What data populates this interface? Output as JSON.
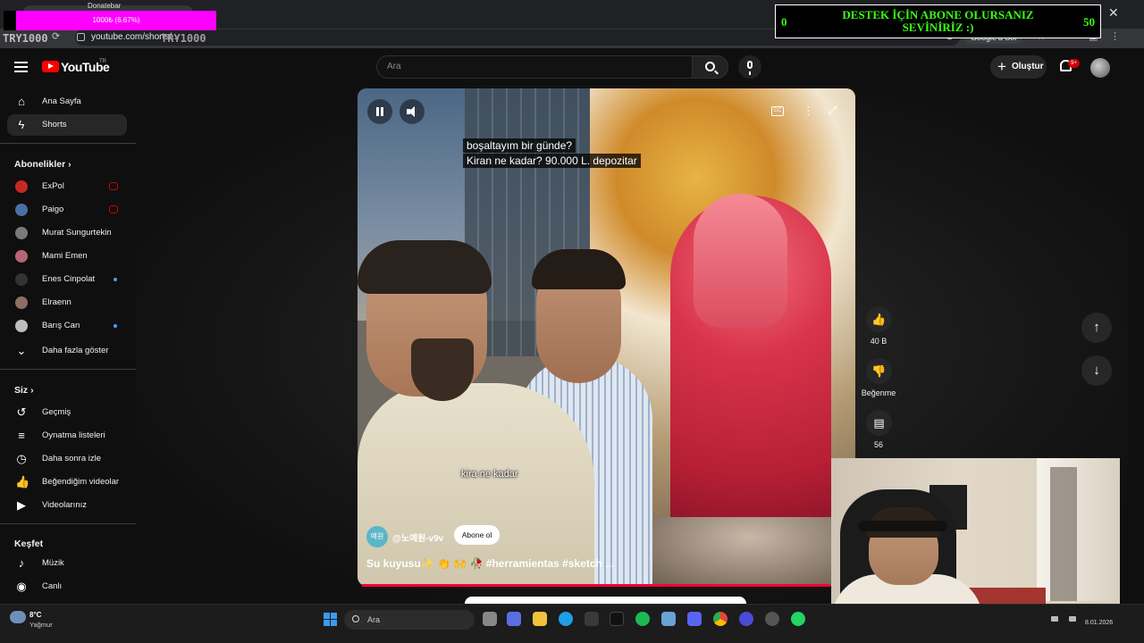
{
  "browser": {
    "url": "youtube.com/shorts/...",
    "translate_pill": "Google'a Sor"
  },
  "overlay": {
    "donate_title": "Donatebar",
    "donate_progress": "1000₺ (6.67%)",
    "try_left": "TRY1000",
    "try_mid": "TRY1000",
    "subscribe_message_line1": "DESTEK İÇİN ABONE OLURSANIZ",
    "subscribe_message_line2": "SEVİNİRİZ :)",
    "counter_left": "0",
    "counter_right": "50"
  },
  "header": {
    "logo_text": "YouTube",
    "logo_region": "TR",
    "search_placeholder": "Ara",
    "create_label": "Oluştur",
    "notif_badge": "9+"
  },
  "sidebar": {
    "nav": [
      {
        "label": "Ana Sayfa",
        "icon": "home-icon"
      },
      {
        "label": "Shorts",
        "icon": "shorts-icon",
        "active": true
      }
    ],
    "subs_title": "Abonelikler",
    "subscriptions": [
      {
        "label": "ExPol",
        "live": true,
        "color": "#c62828"
      },
      {
        "label": "Paigo",
        "live": true,
        "color": "#4a6fa5"
      },
      {
        "label": "Murat Sungurtekin",
        "live": false,
        "color": "#7a7a7a"
      },
      {
        "label": "Mami Emen",
        "live": false,
        "color": "#b56576"
      },
      {
        "label": "Enes Cinpolat",
        "new": true,
        "color": "#333333"
      },
      {
        "label": "Elraenn",
        "live": false,
        "color": "#8d6e63"
      },
      {
        "label": "Barış Can",
        "new": true,
        "color": "#bdbdbd"
      }
    ],
    "show_more": "Daha fazla göster",
    "you_title": "Siz",
    "you_items": [
      {
        "label": "Geçmiş",
        "icon": "history-icon"
      },
      {
        "label": "Oynatma listeleri",
        "icon": "playlist-icon"
      },
      {
        "label": "Daha sonra izle",
        "icon": "clock-icon"
      },
      {
        "label": "Beğendiğim videolar",
        "icon": "thumb-up-icon"
      },
      {
        "label": "Videolarınız",
        "icon": "video-icon"
      }
    ],
    "explore_title": "Keşfet",
    "explore_items": [
      {
        "label": "Müzik",
        "icon": "music-icon"
      },
      {
        "label": "Canlı",
        "icon": "live-icon"
      }
    ]
  },
  "video": {
    "caption_line1": "boşaltayım bir günde?",
    "caption_line2": "Kiran ne kadar? 90.000 L. depozitar",
    "subtitle": "kira ne kadar",
    "channel_avatar_text": "예원",
    "channel_handle": "@노예원-v9v",
    "subscribe_label": "Abone ol",
    "title": "Su kuyusu✨ 👏 🙌 🥀 #herramientas #sketch ...",
    "progress_fraction": 0.95
  },
  "actions": {
    "likes": "40 B",
    "dislike_label": "Beğenme",
    "comments": "56"
  },
  "taskbar": {
    "temperature": "8°C",
    "weather": "Yağmur",
    "search_label": "Ara",
    "date": "8.01.2026"
  }
}
